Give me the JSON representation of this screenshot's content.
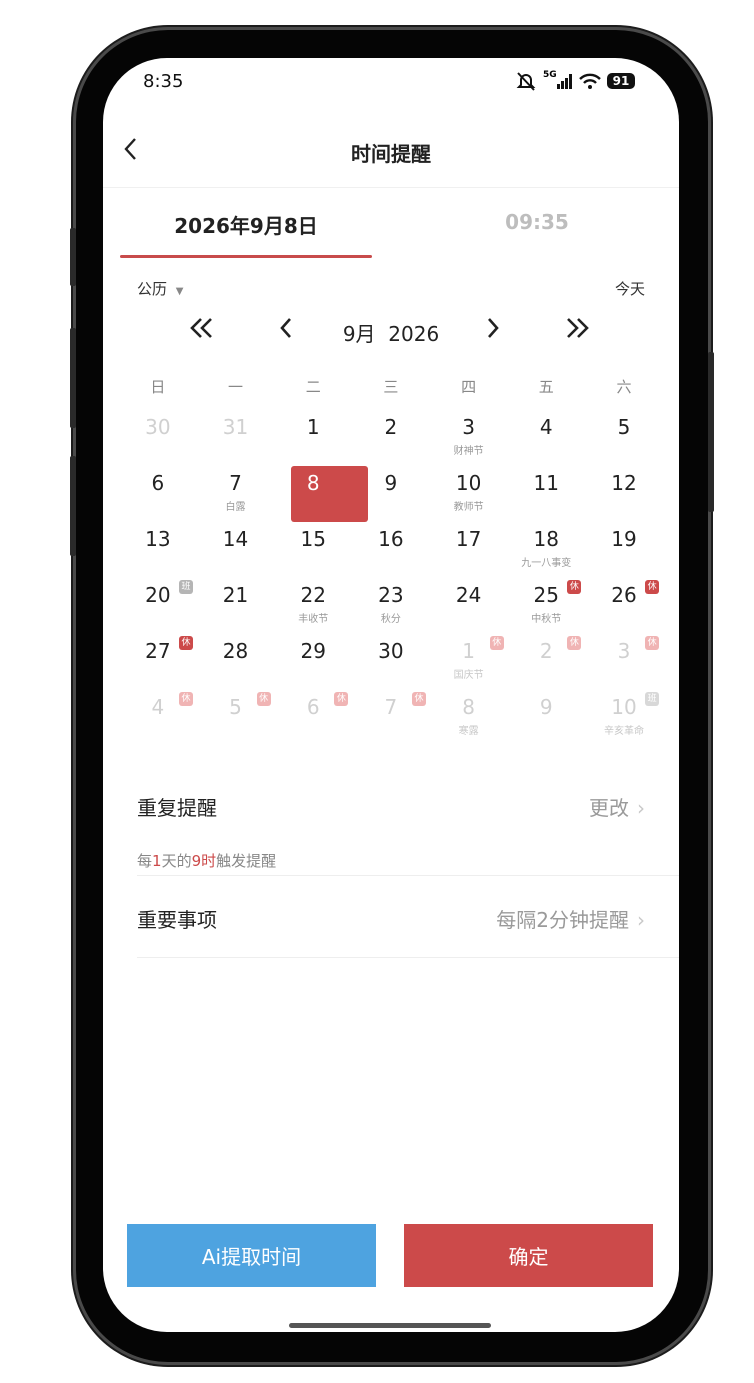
{
  "status": {
    "time": "8:35",
    "network": "5G",
    "battery": "91"
  },
  "nav": {
    "back_icon": "‹",
    "title": "时间提醒"
  },
  "tabs": {
    "date": "2026年9月8日",
    "time": "09:35"
  },
  "calendar": {
    "type": "公历",
    "today": "今天",
    "month_label": "9月",
    "year_label": "2026",
    "weekdays": [
      "日",
      "一",
      "二",
      "三",
      "四",
      "五",
      "六"
    ],
    "days": [
      {
        "d": "30",
        "sub": "",
        "badge": "",
        "dim": true
      },
      {
        "d": "31",
        "sub": "",
        "badge": "",
        "dim": true
      },
      {
        "d": "1",
        "sub": "",
        "badge": "",
        "dim": false
      },
      {
        "d": "2",
        "sub": "",
        "badge": "",
        "dim": false
      },
      {
        "d": "3",
        "sub": "财神节",
        "badge": "",
        "dim": false
      },
      {
        "d": "4",
        "sub": "",
        "badge": "",
        "dim": false
      },
      {
        "d": "5",
        "sub": "",
        "badge": "",
        "dim": false
      },
      {
        "d": "6",
        "sub": "",
        "badge": "",
        "dim": false
      },
      {
        "d": "7",
        "sub": "白露",
        "badge": "",
        "dim": false
      },
      {
        "d": "8",
        "sub": "",
        "badge": "",
        "dim": false,
        "selected": true
      },
      {
        "d": "9",
        "sub": "",
        "badge": "",
        "dim": false
      },
      {
        "d": "10",
        "sub": "教师节",
        "badge": "",
        "dim": false
      },
      {
        "d": "11",
        "sub": "",
        "badge": "",
        "dim": false
      },
      {
        "d": "12",
        "sub": "",
        "badge": "",
        "dim": false
      },
      {
        "d": "13",
        "sub": "",
        "badge": "",
        "dim": false
      },
      {
        "d": "14",
        "sub": "",
        "badge": "",
        "dim": false
      },
      {
        "d": "15",
        "sub": "",
        "badge": "",
        "dim": false
      },
      {
        "d": "16",
        "sub": "",
        "badge": "",
        "dim": false
      },
      {
        "d": "17",
        "sub": "",
        "badge": "",
        "dim": false
      },
      {
        "d": "18",
        "sub": "九一八事变",
        "badge": "",
        "dim": false
      },
      {
        "d": "19",
        "sub": "",
        "badge": "",
        "dim": false
      },
      {
        "d": "20",
        "sub": "",
        "badge": "班",
        "dim": false
      },
      {
        "d": "21",
        "sub": "",
        "badge": "",
        "dim": false
      },
      {
        "d": "22",
        "sub": "丰收节",
        "badge": "",
        "dim": false
      },
      {
        "d": "23",
        "sub": "秋分",
        "badge": "",
        "dim": false
      },
      {
        "d": "24",
        "sub": "",
        "badge": "",
        "dim": false
      },
      {
        "d": "25",
        "sub": "中秋节",
        "badge": "休",
        "dim": false
      },
      {
        "d": "26",
        "sub": "",
        "badge": "休",
        "dim": false
      },
      {
        "d": "27",
        "sub": "",
        "badge": "休",
        "dim": false
      },
      {
        "d": "28",
        "sub": "",
        "badge": "",
        "dim": false
      },
      {
        "d": "29",
        "sub": "",
        "badge": "",
        "dim": false
      },
      {
        "d": "30",
        "sub": "",
        "badge": "",
        "dim": false
      },
      {
        "d": "1",
        "sub": "国庆节",
        "badge": "休",
        "dim": true
      },
      {
        "d": "2",
        "sub": "",
        "badge": "休",
        "dim": true
      },
      {
        "d": "3",
        "sub": "",
        "badge": "休",
        "dim": true
      },
      {
        "d": "4",
        "sub": "",
        "badge": "休",
        "dim": true
      },
      {
        "d": "5",
        "sub": "",
        "badge": "休",
        "dim": true
      },
      {
        "d": "6",
        "sub": "",
        "badge": "休",
        "dim": true
      },
      {
        "d": "7",
        "sub": "",
        "badge": "休",
        "dim": true
      },
      {
        "d": "8",
        "sub": "寒露",
        "badge": "",
        "dim": true
      },
      {
        "d": "9",
        "sub": "",
        "badge": "",
        "dim": true
      },
      {
        "d": "10",
        "sub": "辛亥革命",
        "badge": "班",
        "dim": true
      }
    ]
  },
  "repeat": {
    "label": "重复提醒",
    "action": "更改",
    "summary_prefix": "每",
    "summary_n": "1",
    "summary_mid": "天的",
    "summary_h": "9时",
    "summary_suffix": "触发提醒"
  },
  "important": {
    "label": "重要事项",
    "value": "每隔2分钟提醒"
  },
  "buttons": {
    "ai": "Ai提取时间",
    "confirm": "确定"
  },
  "colors": {
    "accent": "#cc4a4a",
    "ai": "#4ea3e0"
  }
}
